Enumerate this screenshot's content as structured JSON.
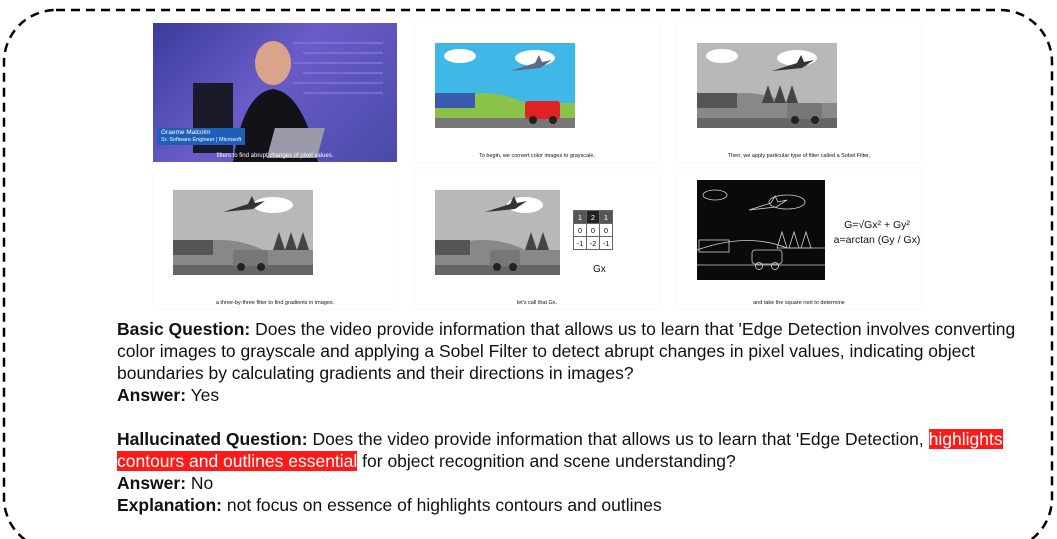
{
  "panels": {
    "p1": {
      "name_line1": "Graeme Malcolm",
      "name_line2": "Sr. Software Engineer | Microsoft",
      "caption": "filters to find abrupt changes of pixel values."
    },
    "p2": {
      "caption": "To begin, we convert color images to grayscale,"
    },
    "p3": {
      "caption": "Then, we apply particular type of filter called a Sobel Filter,"
    },
    "p4": {
      "caption": "a three-by-three filter to find gradients in images."
    },
    "p5": {
      "caption": "let's call that Gx.",
      "matrix": [
        [
          "1",
          "2",
          "1"
        ],
        [
          "0",
          "0",
          "0"
        ],
        [
          "-1",
          "-2",
          "-1"
        ]
      ],
      "matrix_label": "Gx"
    },
    "p6": {
      "caption": "and take the square root to determine",
      "formula_line1": "G=√Gx² + Gy²",
      "formula_line2": "a=arctan (Gy / Gx)"
    }
  },
  "qa": {
    "basic_label": "Basic Question:",
    "basic_text": " Does the video provide information that allows us to learn that 'Edge Detection involves converting color images to grayscale and applying a Sobel Filter to detect abrupt changes in pixel values, indicating object boundaries by calculating gradients and their directions in images?",
    "answer1_label": "Answer:",
    "answer1_text": " Yes",
    "halluc_label": "Hallucinated Question:",
    "halluc_text_a": " Does the video provide information that allows us to learn that 'Edge Detection, ",
    "halluc_highlight": "highlights contours and outlines essential",
    "halluc_text_b": " for object recognition and scene understanding?",
    "answer2_label": "Answer:",
    "answer2_text": " No",
    "explanation_label": "Explanation:",
    "explanation_text": " not focus on essence of highlights contours and outlines"
  },
  "colors": {
    "highlight": "#ff1a1a",
    "name_box": "#1f5fb8"
  }
}
